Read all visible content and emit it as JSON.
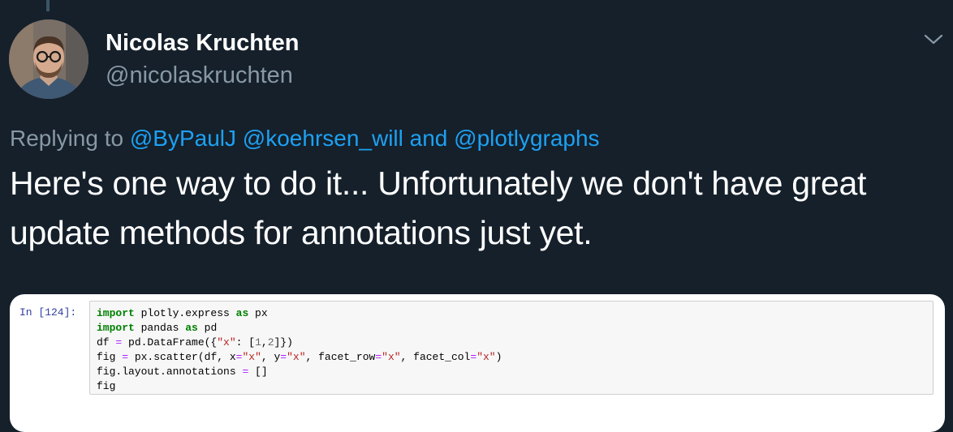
{
  "tweet": {
    "author": {
      "name": "Nicolas Kruchten",
      "handle": "@nicolaskruchten"
    },
    "reply_context": {
      "prefix": "Replying to ",
      "mentions": [
        "@ByPaulJ",
        "@koehrsen_will"
      ],
      "connector": " and ",
      "last_mention": "@plotlygraphs"
    },
    "text_line_1": "Here's one way to do it... Unfortunately we don't have great",
    "text_line_2": "update methods for annotations just yet.",
    "media": {
      "prompt": "In [124]:",
      "code": {
        "line1": {
          "kw1": "import",
          "mid": " plotly.express ",
          "kw2": "as",
          "end": " px"
        },
        "line2": {
          "kw1": "import",
          "mid": " pandas ",
          "kw2": "as",
          "end": " pd"
        },
        "line3": {
          "a": "df ",
          "op": "=",
          "b": " pd.DataFrame({",
          "s1": "\"x\"",
          "c": ": [",
          "n1": "1",
          "d": ",",
          "n2": "2",
          "e": "]})"
        },
        "line4": {
          "a": "fig ",
          "op": "=",
          "b": " px.scatter(df, x",
          "op2": "=",
          "s1": "\"x\"",
          "c": ", y",
          "op3": "=",
          "s2": "\"x\"",
          "d": ", facet_row",
          "op4": "=",
          "s3": "\"x\"",
          "e": ", facet_col",
          "op5": "=",
          "s4": "\"x\"",
          "f": ")"
        },
        "line5": {
          "a": "fig.layout.annotations ",
          "op": "=",
          "b": " []"
        },
        "line6": {
          "a": "fig"
        }
      }
    }
  },
  "colors": {
    "background": "#15202b",
    "secondary_text": "#8899a6",
    "link": "#1da1f2",
    "primary_text": "#ffffff"
  },
  "icons": {
    "menu_caret": "chevron-down-icon"
  }
}
